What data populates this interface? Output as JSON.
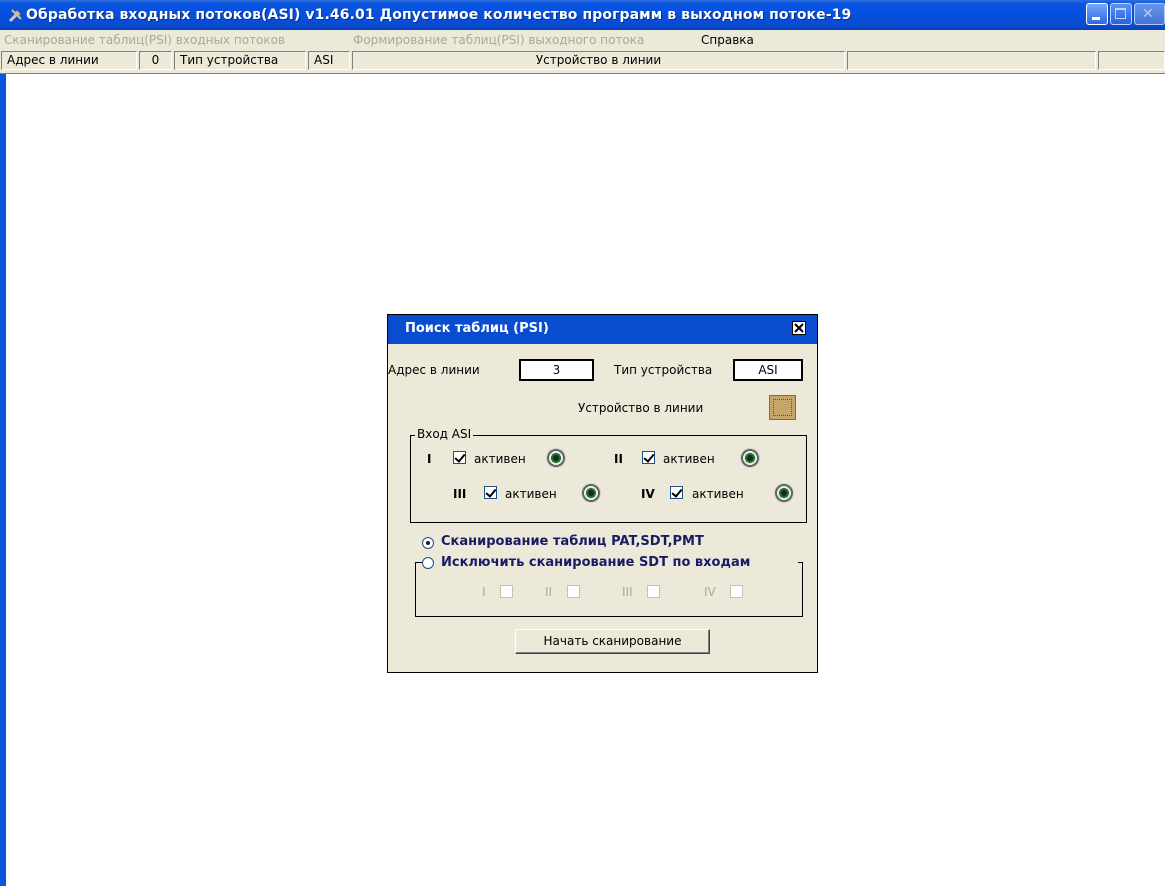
{
  "window": {
    "title": "Обработка входных потоков(ASI)  v1.46.01 Допустимое количество программ в выходном потоке-19",
    "icon": "tools-icon"
  },
  "menu": {
    "items": [
      {
        "label": "Сканирование таблиц(PSI) входных потоков",
        "enabled": false
      },
      {
        "label": "Формирование таблиц(PSI) выходного потока",
        "enabled": false
      },
      {
        "label": "Справка",
        "enabled": true
      }
    ]
  },
  "header": {
    "address_label": "Адрес в линии",
    "address_value": "0",
    "device_type_label": "Тип устройства",
    "device_type_value": "ASI",
    "device_online_label": "Устройство в линии"
  },
  "dialog": {
    "title": "Поиск таблиц (PSI)",
    "address_label": "Адрес в линии",
    "address_value": "3",
    "device_type_label": "Тип устройства",
    "device_type_value": "ASI",
    "device_online_label": "Устройство в линии",
    "asi_group_title": "Вход ASI",
    "inputs": [
      {
        "roman": "I",
        "label": "активен",
        "checked": true
      },
      {
        "roman": "II",
        "label": "активен",
        "checked": true
      },
      {
        "roman": "III",
        "label": "активен",
        "checked": true
      },
      {
        "roman": "IV",
        "label": "активен",
        "checked": true
      }
    ],
    "radio_scan_label": "Сканирование таблиц PAT,SDT,PMT",
    "radio_exclude_label": "Исключить сканирование SDT по входам",
    "exclude_inputs": [
      "I",
      "II",
      "III",
      "IV"
    ],
    "start_button": "Начать сканирование"
  },
  "colors": {
    "title_bar": "#0550de",
    "face": "#ece9d8",
    "disabled_text": "#aca899"
  }
}
